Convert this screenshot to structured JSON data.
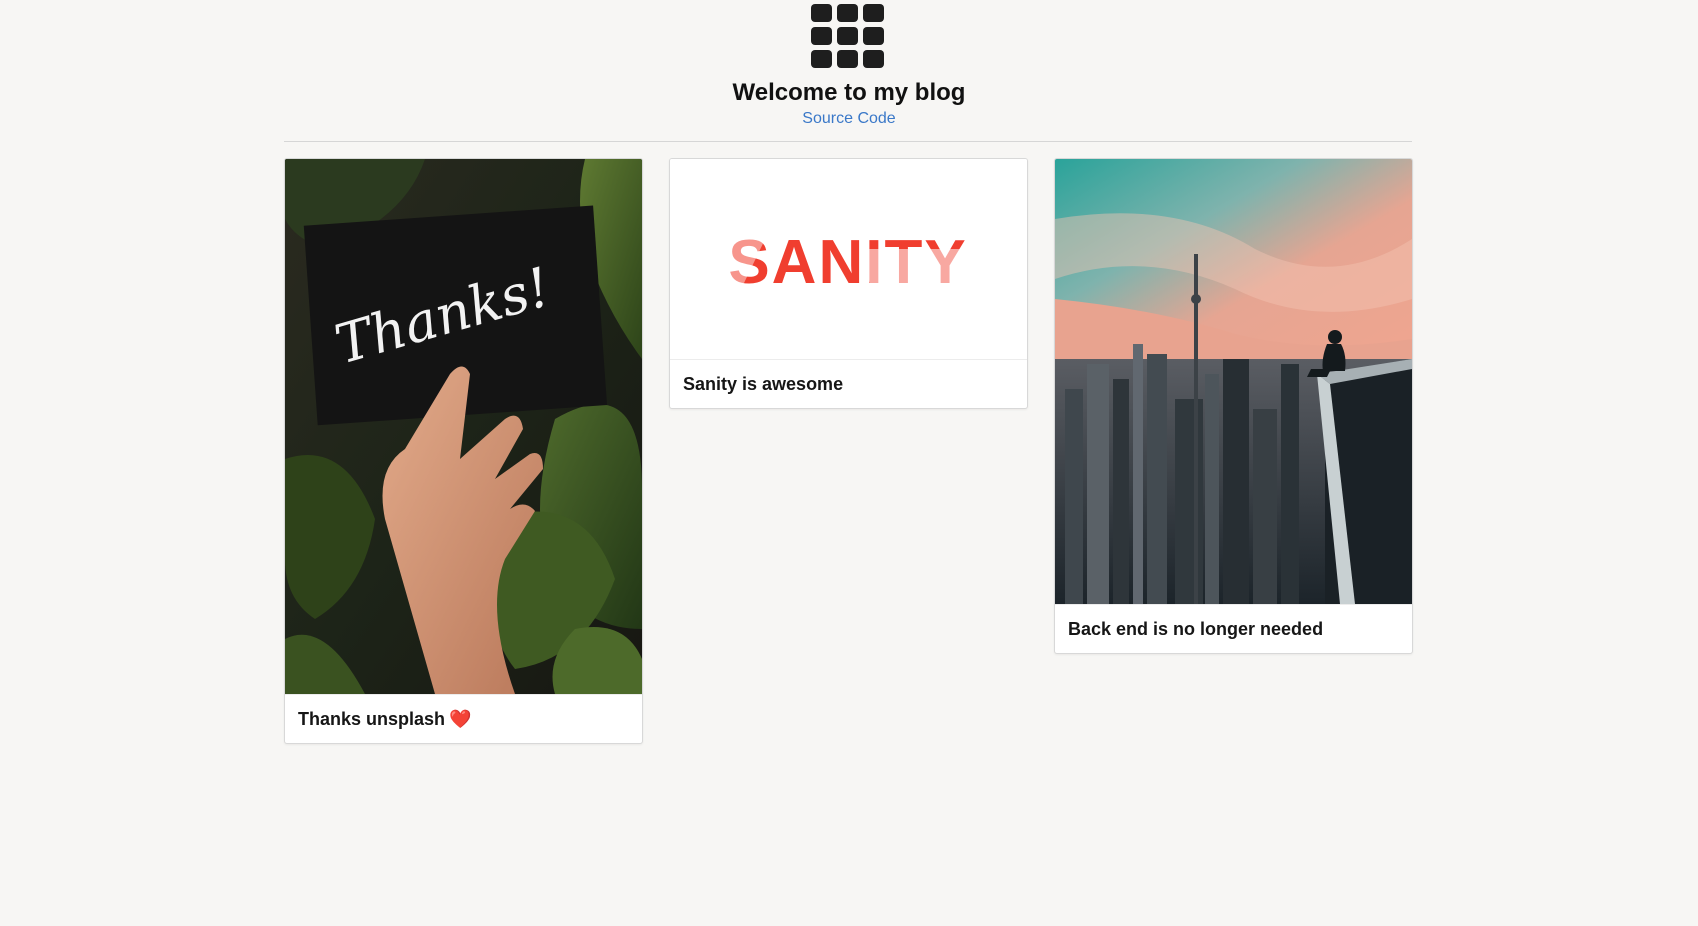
{
  "header": {
    "logo_icon": "grid-icon",
    "title": "Welcome to my blog",
    "source_link": "Source Code"
  },
  "posts": [
    {
      "title": "Thanks unsplash",
      "emoji": "❤️",
      "image": "hand holding a black card with handwritten text among green leaves",
      "image_text": "Thanks!"
    },
    {
      "title": "Sanity is awesome",
      "image": "Sanity logo",
      "image_text": "SANITY"
    },
    {
      "title": "Back end is no longer needed",
      "image": "person sitting on a rooftop edge overlooking a city skyline at sunset"
    }
  ],
  "colors": {
    "background": "#f7f6f4",
    "link": "#3a78c8",
    "sanity_red": "#f03e2f"
  }
}
